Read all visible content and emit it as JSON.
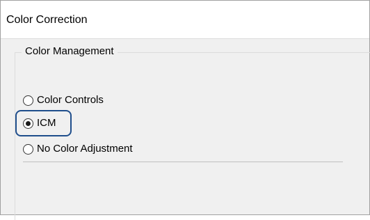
{
  "window": {
    "title": "Color Correction"
  },
  "group": {
    "label": "Color Management",
    "options": [
      {
        "label": "Color Controls",
        "checked": false
      },
      {
        "label": "ICM",
        "checked": true
      },
      {
        "label": "No Color Adjustment",
        "checked": false
      }
    ]
  },
  "colors": {
    "highlight": "#1f4e8c",
    "dialog_background": "#f0f0f0",
    "title_background": "#ffffff"
  }
}
